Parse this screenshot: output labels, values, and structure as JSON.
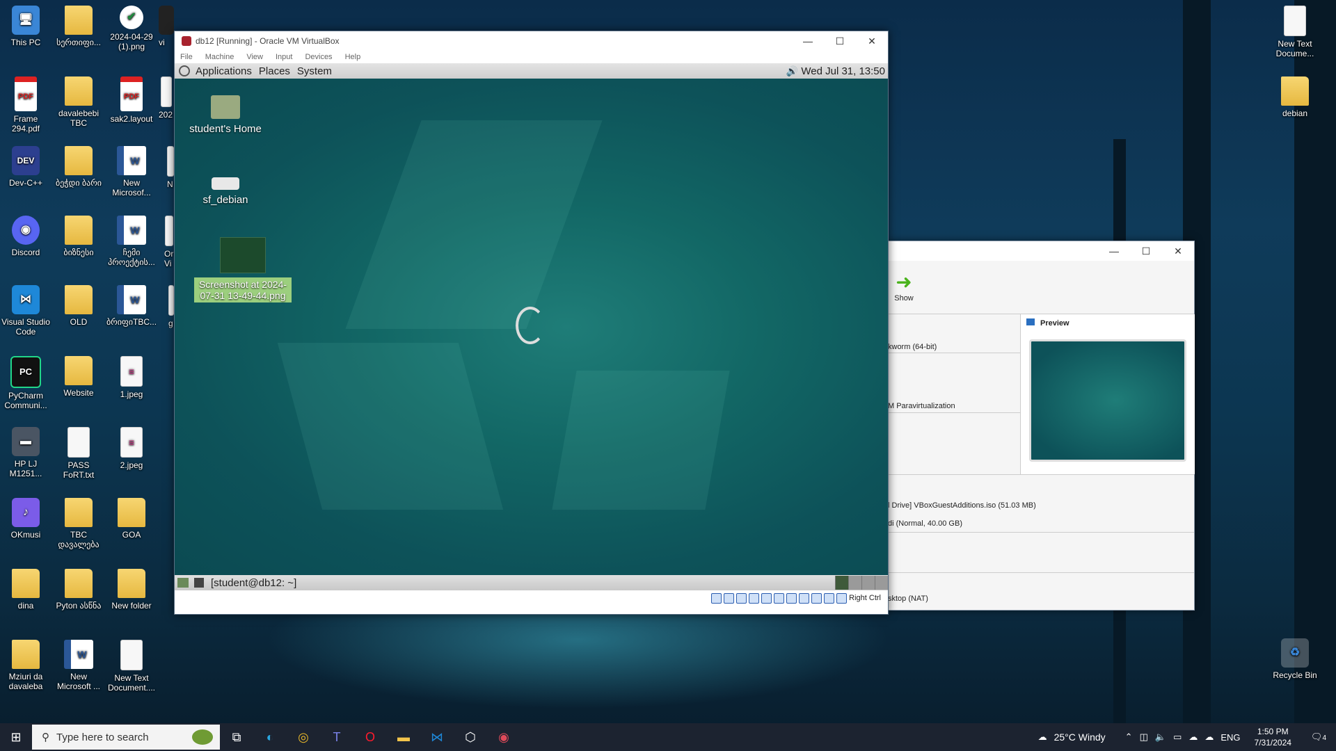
{
  "desktop_icons": [
    {
      "label": "This PC",
      "glyph": "🖥"
    },
    {
      "label": "სერთიფი...",
      "glyph": "📄"
    },
    {
      "label": "2024-04-29 (1).png",
      "glyph": "✔"
    },
    {
      "label": "vi",
      "glyph": "▪"
    },
    {
      "label": "Frame 294.pdf",
      "glyph": "PDF"
    },
    {
      "label": "davalebebi TBC",
      "glyph": "📄"
    },
    {
      "label": "sak2.layout",
      "glyph": "PDF"
    },
    {
      "label": "202",
      "glyph": "▪"
    },
    {
      "label": "Dev-C++",
      "glyph": "DEV"
    },
    {
      "label": "ბეჭდი ბარი",
      "glyph": "📄"
    },
    {
      "label": "New Microsof...",
      "glyph": "W"
    },
    {
      "label": "N",
      "glyph": "▪"
    },
    {
      "label": "Discord",
      "glyph": "◉"
    },
    {
      "label": "ბიზნესი",
      "glyph": "📄"
    },
    {
      "label": "ჩემი პროექტის...",
      "glyph": "W"
    },
    {
      "label": "Or Vi",
      "glyph": "▪"
    },
    {
      "label": "Visual Studio Code",
      "glyph": "⋈"
    },
    {
      "label": "OLD",
      "glyph": "📄"
    },
    {
      "label": "ბრიფიTBC...",
      "glyph": "W"
    },
    {
      "label": "g",
      "glyph": "▪"
    },
    {
      "label": "PyCharm Communi...",
      "glyph": "PC"
    },
    {
      "label": "Website",
      "glyph": ""
    },
    {
      "label": "1.jpeg",
      "glyph": "≡"
    },
    {
      "label": "HP LJ M1251...",
      "glyph": "▬"
    },
    {
      "label": "PASS FoRT.txt",
      "glyph": "≡"
    },
    {
      "label": "2.jpeg",
      "glyph": "≡"
    },
    {
      "label": "OKmusi",
      "glyph": "♪"
    },
    {
      "label": "TBC დავალება",
      "glyph": "📄"
    },
    {
      "label": "GOA",
      "glyph": ""
    },
    {
      "label": "dina",
      "glyph": "📄"
    },
    {
      "label": "Pyton ასწნა",
      "glyph": "📄"
    },
    {
      "label": "New folder",
      "glyph": "📄"
    },
    {
      "label": "Mziuri da davaleba",
      "glyph": "📄"
    },
    {
      "label": "New Microsoft ...",
      "glyph": "W"
    },
    {
      "label": "New Text Document....",
      "glyph": "≡"
    },
    {
      "label": "New Text Docume...",
      "glyph": "≡"
    },
    {
      "label": "debian",
      "glyph": ""
    },
    {
      "label": "Recycle Bin",
      "glyph": "♻"
    }
  ],
  "vm_window": {
    "title": "db12 [Running] - Oracle VM VirtualBox",
    "menu": [
      "File",
      "Machine",
      "View",
      "Input",
      "Devices",
      "Help"
    ],
    "controls": {
      "minimize": "—",
      "maximize": "☐",
      "close": "✕"
    },
    "guest": {
      "top_menu": [
        "Applications",
        "Places",
        "System"
      ],
      "clock": "Wed Jul 31, 13:50",
      "icons": [
        {
          "label": "student's Home"
        },
        {
          "label": "sf_debian"
        },
        {
          "label": "Screenshot at 2024-07-31 13-49-44.png"
        }
      ],
      "task_label": "[student@db12: ~]"
    },
    "host_key": "Right Ctrl"
  },
  "manager_window": {
    "controls": {
      "minimize": "—",
      "maximize": "☐",
      "close": "✕"
    },
    "show_label": "Show",
    "preview_label": "Preview",
    "details": [
      "kworm (64-bit)",
      "M Paravirtualization",
      "l Drive] VBoxGuestAdditions.iso (51.03 MB)",
      "di (Normal, 40.00 GB)",
      "sktop (NAT)"
    ]
  },
  "taskbar": {
    "search_placeholder": "Type here to search",
    "apps": [
      "task-view",
      "edge",
      "chrome",
      "teams",
      "opera",
      "file-explorer",
      "vscode",
      "virtualbox",
      "virtualbox-vm"
    ],
    "weather": "25°C  Windy",
    "language": "ENG",
    "time": "1:50 PM",
    "date": "7/31/2024",
    "notifications": "4"
  },
  "colors": {
    "taskbar": "#1c2330",
    "guest_teal": "#126765",
    "accent": "#2a6fc0"
  }
}
